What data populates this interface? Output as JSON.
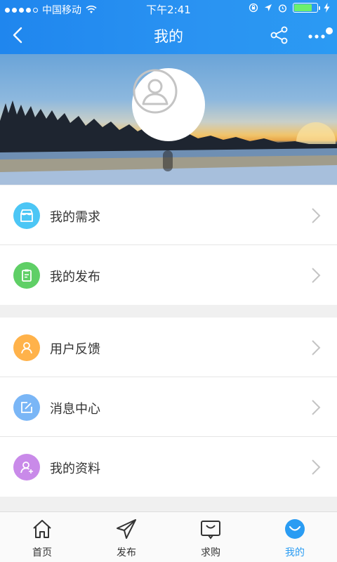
{
  "status_bar": {
    "carrier": "中国移动",
    "time": "下午2:41"
  },
  "nav": {
    "title": "我的",
    "icons": [
      "back-icon",
      "share-icon",
      "more-icon"
    ]
  },
  "profile": {
    "avatar_icon": "user-avatar-icon"
  },
  "menu_groups": [
    {
      "items": [
        {
          "label": "我的需求",
          "icon": "shop-icon",
          "color": "#4cc6f5"
        },
        {
          "label": "我的发布",
          "icon": "clipboard-icon",
          "color": "#5fcf66"
        }
      ]
    },
    {
      "items": [
        {
          "label": "用户反馈",
          "icon": "person-icon",
          "color": "#ffb24a"
        },
        {
          "label": "消息中心",
          "icon": "edit-icon",
          "color": "#7ab6f6"
        },
        {
          "label": "我的资料",
          "icon": "add-user-icon",
          "color": "#c98ae9"
        }
      ]
    }
  ],
  "tabbar": {
    "tabs": [
      {
        "label": "首页",
        "icon": "home-icon"
      },
      {
        "label": "发布",
        "icon": "send-icon"
      },
      {
        "label": "求购",
        "icon": "inbox-icon"
      },
      {
        "label": "我的",
        "icon": "face-icon"
      }
    ],
    "active_color": "#2a9cf3"
  }
}
